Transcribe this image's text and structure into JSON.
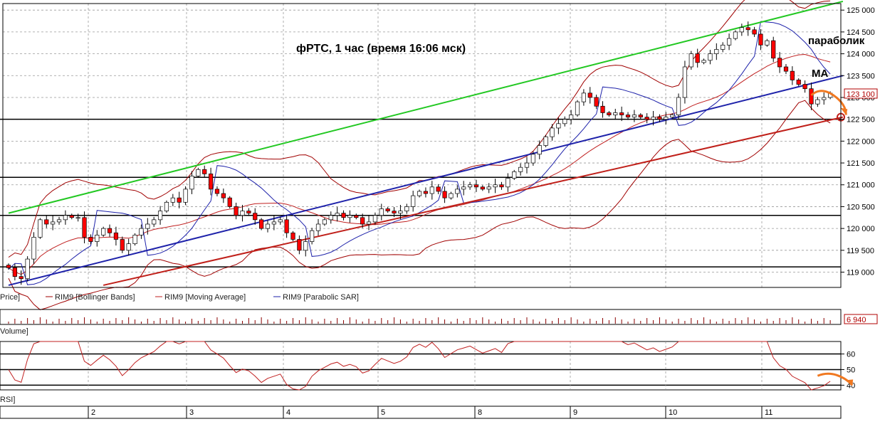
{
  "chart_data": [
    {
      "type": "candlestick",
      "title": "фРТС,  1 час  (время 16:06 мск)",
      "x_labels": [
        "2",
        "3",
        "4",
        "5",
        "8",
        "9",
        "10",
        "11"
      ],
      "ylim": [
        118650,
        125150
      ],
      "y_ticks": [
        {
          "value": 119000,
          "label": "119 000"
        },
        {
          "value": 119500,
          "label": "119 500"
        },
        {
          "value": 120000,
          "label": "120 000"
        },
        {
          "value": 120500,
          "label": "120 500"
        },
        {
          "value": 121000,
          "label": "121 000"
        },
        {
          "value": 121500,
          "label": "121 500"
        },
        {
          "value": 122000,
          "label": "122 000"
        },
        {
          "value": 122500,
          "label": "122 500"
        },
        {
          "value": 123000,
          "label": "123 000"
        },
        {
          "value": 123500,
          "label": "123 500"
        },
        {
          "value": 124000,
          "label": "124 000"
        },
        {
          "value": 124500,
          "label": "124 500"
        },
        {
          "value": 125000,
          "label": "125 000"
        }
      ],
      "last_value": {
        "value": 123100,
        "label": "123 100"
      },
      "horizontal_levels": [
        119120,
        120300,
        121170,
        122500
      ],
      "close_series": [
        119100,
        118900,
        118850,
        119300,
        119800,
        120200,
        120100,
        120150,
        120200,
        120300,
        120250,
        120250,
        119800,
        119700,
        119850,
        120000,
        119900,
        119750,
        119500,
        119650,
        119850,
        120000,
        120100,
        120200,
        120400,
        120600,
        120700,
        120600,
        120900,
        121200,
        121350,
        121250,
        120900,
        120800,
        120700,
        120500,
        120300,
        120400,
        120350,
        120200,
        120000,
        120100,
        120150,
        120200,
        119900,
        119750,
        119500,
        119700,
        119950,
        120100,
        120200,
        120300,
        120350,
        120250,
        120300,
        120250,
        120100,
        120150,
        120300,
        120450,
        120400,
        120350,
        120400,
        120500,
        120750,
        120850,
        120800,
        120950,
        120850,
        120700,
        120800,
        120900,
        120950,
        121000,
        120950,
        120900,
        120950,
        121000,
        120950,
        121150,
        121300,
        121400,
        121500,
        121700,
        121900,
        122100,
        122300,
        122400,
        122500,
        122600,
        122900,
        123100,
        123000,
        122800,
        122650,
        122600,
        122650,
        122600,
        122550,
        122600,
        122550,
        122500,
        122550,
        122500,
        122550,
        122600,
        123000,
        123700,
        124000,
        123800,
        123850,
        124000,
        124100,
        124200,
        124350,
        124500,
        124600,
        124550,
        124450,
        124200,
        124300,
        123900,
        123700,
        123600,
        123400,
        123300,
        123200,
        122850,
        122950,
        123000,
        123100
      ],
      "trendlines": [
        {
          "color": "#22c822",
          "from": [
            0,
            120350
          ],
          "to": [
            132,
            125200
          ]
        },
        {
          "color": "#1e22aa",
          "from": [
            0,
            118700
          ],
          "to": [
            132,
            123500
          ]
        },
        {
          "color": "#c0201a",
          "from": [
            15,
            118700
          ],
          "to": [
            132,
            122550
          ]
        }
      ],
      "forecast_arrow": {
        "color": "#f07820",
        "points": [
          [
            127,
            123050
          ],
          [
            128.5,
            123250
          ],
          [
            130.5,
            123050
          ],
          [
            132.5,
            122600
          ]
        ]
      },
      "target_marker": {
        "value": 122550,
        "color": "#c0201a"
      },
      "annotations": [
        {
          "text": "параболик",
          "value": 124350
        },
        {
          "text": "MA",
          "value": 123300
        }
      ],
      "colors": {
        "up": "#ffffff",
        "down": "#ff0000",
        "bollinger": "#a00000",
        "sar": "#1e22aa",
        "ma": "#c02020"
      }
    },
    {
      "type": "bar",
      "series_legend": "Volume]",
      "last_value": {
        "value": 6940,
        "label": "6 940"
      },
      "color": "#8b0000"
    },
    {
      "type": "line",
      "series_legend": "RSI]",
      "ylim": [
        37,
        68
      ],
      "y_ticks": [
        {
          "value": 40,
          "label": "40"
        },
        {
          "value": 50,
          "label": "50"
        },
        {
          "value": 60,
          "label": "60"
        }
      ],
      "levels": [
        40,
        50,
        60
      ],
      "forecast_arrow": {
        "color": "#f07820",
        "points": [
          [
            128,
            46
          ],
          [
            129.5,
            48.5
          ],
          [
            131,
            46.5
          ],
          [
            133.5,
            40
          ]
        ]
      },
      "color": "#c02020"
    }
  ],
  "legend": [
    "Price]",
    "RIM9 [Bollinger Bands]",
    "RIM9 [Moving Average]",
    "RIM9 [Parabolic SAR]"
  ]
}
